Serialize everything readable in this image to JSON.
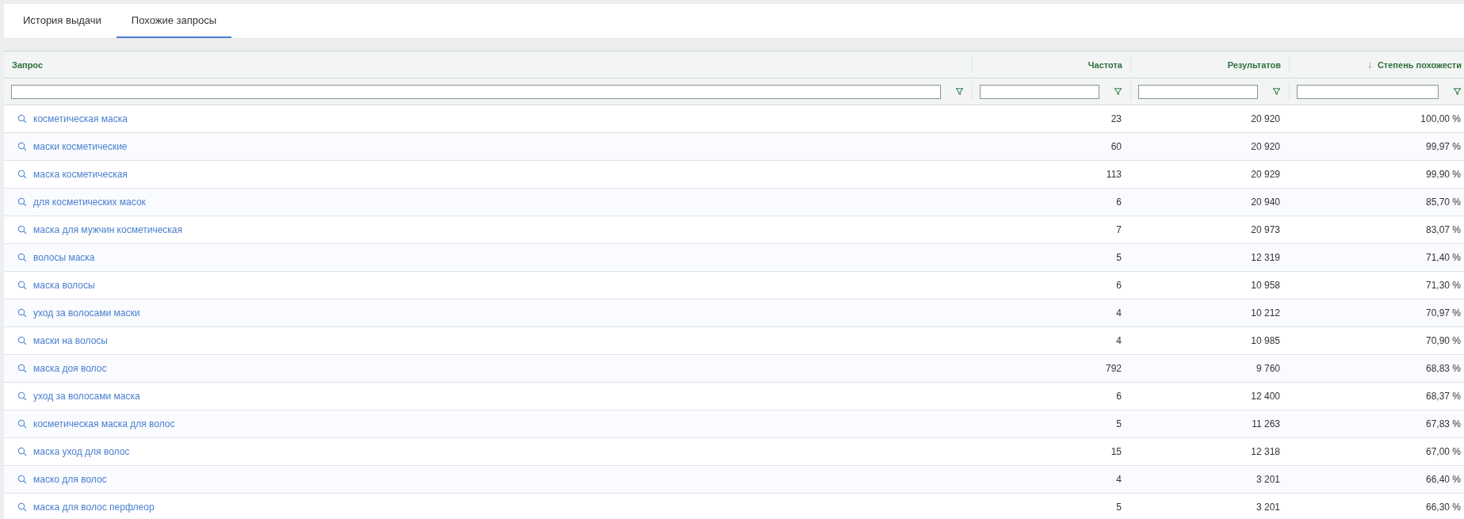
{
  "tabs": [
    {
      "label": "История выдачи",
      "selected": false
    },
    {
      "label": "Похожие запросы",
      "selected": true
    }
  ],
  "table": {
    "columns": [
      {
        "label": "Запрос"
      },
      {
        "label": "Частота"
      },
      {
        "label": "Результатов"
      },
      {
        "label": "Степень похожести",
        "sort_arrow": "↓"
      }
    ],
    "rows": [
      {
        "query": "косметическая маска",
        "frequency": "23",
        "results": "20 920",
        "similarity": "100,00 %"
      },
      {
        "query": "маски косметические",
        "frequency": "60",
        "results": "20 920",
        "similarity": "99,97 %"
      },
      {
        "query": "маска косметическая",
        "frequency": "113",
        "results": "20 929",
        "similarity": "99,90 %"
      },
      {
        "query": "для косметических масок",
        "frequency": "6",
        "results": "20 940",
        "similarity": "85,70 %"
      },
      {
        "query": "маска для мужчин косметическая",
        "frequency": "7",
        "results": "20 973",
        "similarity": "83,07 %"
      },
      {
        "query": "волосы маска",
        "frequency": "5",
        "results": "12 319",
        "similarity": "71,40 %"
      },
      {
        "query": "маска волосы",
        "frequency": "6",
        "results": "10 958",
        "similarity": "71,30 %"
      },
      {
        "query": "уход за волосами маски",
        "frequency": "4",
        "results": "10 212",
        "similarity": "70,97 %"
      },
      {
        "query": "маски на волосы",
        "frequency": "4",
        "results": "10 985",
        "similarity": "70,90 %"
      },
      {
        "query": "маска доя волос",
        "frequency": "792",
        "results": "9 760",
        "similarity": "68,83 %"
      },
      {
        "query": "уход за волосами маска",
        "frequency": "6",
        "results": "12 400",
        "similarity": "68,37 %"
      },
      {
        "query": "косметическая маска для волос",
        "frequency": "5",
        "results": "11 263",
        "similarity": "67,83 %"
      },
      {
        "query": "маска уход для волос",
        "frequency": "15",
        "results": "12 318",
        "similarity": "67,00 %"
      },
      {
        "query": "маско для волос",
        "frequency": "4",
        "results": "3 201",
        "similarity": "66,40 %"
      },
      {
        "query": "маска для волос перфлеор",
        "frequency": "5",
        "results": "3 201",
        "similarity": "66,30 %"
      }
    ]
  }
}
